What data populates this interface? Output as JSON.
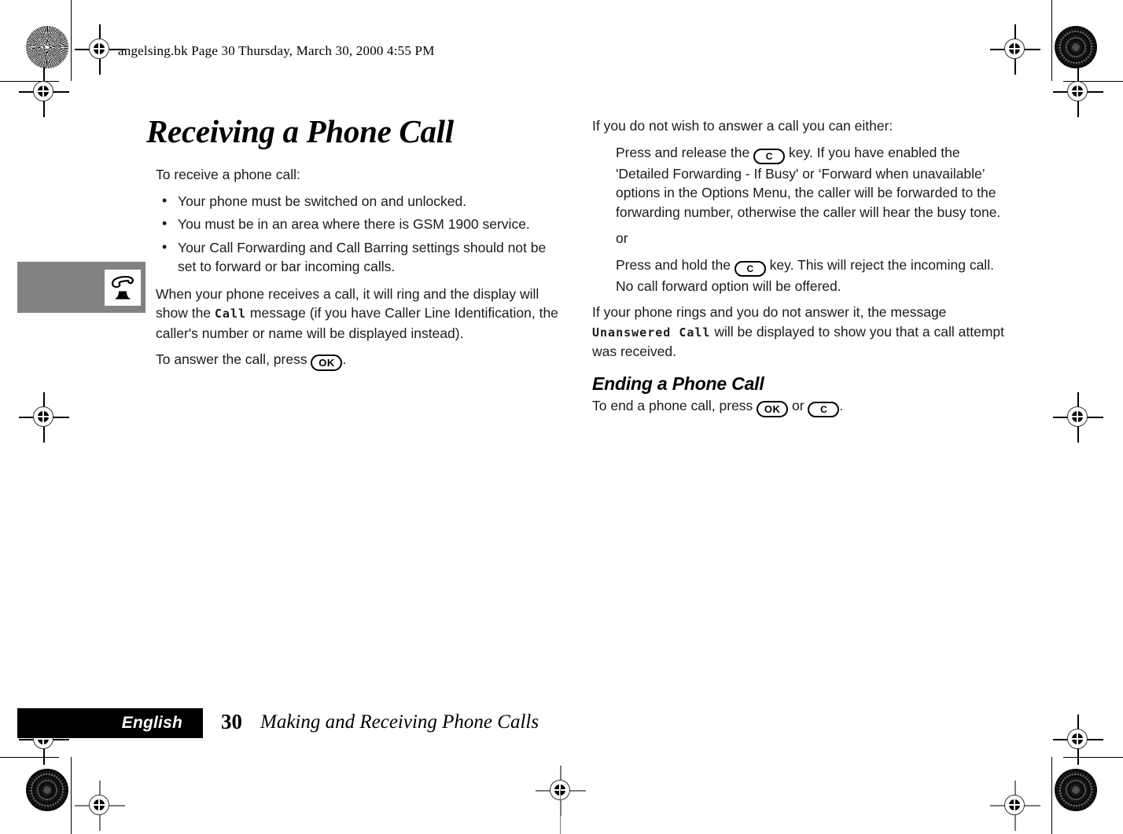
{
  "slug": {
    "text": "angelsing.bk  Page 30  Thursday, March 30, 2000  4:55 PM"
  },
  "left_column": {
    "title": "Receiving a Phone Call",
    "intro": "To receive a phone call:",
    "bullets": [
      "Your phone must be switched on and unlocked.",
      "You must be in an area where there is GSM 1900 service.",
      "Your Call Forwarding and Call Barring settings should not be set to forward or bar incoming calls."
    ],
    "ring_para_1": "When your phone receives a call, it will ring and the display will show the ",
    "ring_lcd": "Call",
    "ring_para_2": " message (if you have Caller Line Identification, the caller's number or name will be displayed instead).",
    "answer_para_1": "To answer the call, press ",
    "answer_key": "OK",
    "answer_para_2": "."
  },
  "right_column": {
    "intro": "If you do not wish to answer a call you can either:",
    "option_1_pre": "Press and release the ",
    "option_1_key": "C",
    "option_1_post": " key. If you have enabled the 'Detailed Forwarding - If Busy' or ‘Forward when unavailable’ options in the Options Menu, the caller will be forwarded to the forwarding number, otherwise the caller will hear the busy tone.",
    "or_label": "or",
    "option_2_pre": "Press and hold the ",
    "option_2_key": "C",
    "option_2_post": " key. This will reject the incoming call. No call forward option will be offered.",
    "unanswered_pre": "If your phone rings and you do not answer it, the message ",
    "unanswered_lcd": "Unanswered Call",
    "unanswered_post": " will be displayed to show you that a call attempt was received.",
    "ending_heading": "Ending a Phone Call",
    "ending_pre": "To end a phone call, press ",
    "ending_key_1": "OK",
    "ending_or": " or ",
    "ending_key_2": "C",
    "ending_post": "."
  },
  "side_tab": {
    "icon": "phone-handset-icon"
  },
  "footer": {
    "language": "English",
    "page_number": "30",
    "chapter": "Making and Receiving Phone Calls"
  },
  "colors": {
    "side_tab_grey": "#828282",
    "footer_bar_black": "#000000",
    "text": "#1b1b1b"
  }
}
